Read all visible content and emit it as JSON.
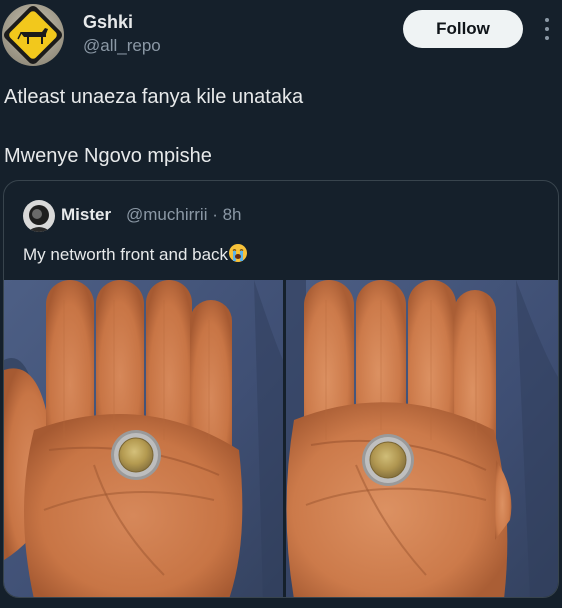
{
  "tweet": {
    "author_name": "Gshki",
    "author_handle": "@all_repo",
    "follow_label": "Follow",
    "avatar_icon": "cow-crossing-sign-icon",
    "text_lines": [
      "Atleast unaeza fanya kile unataka",
      "Mwenye Ngovo mpishe"
    ]
  },
  "quote": {
    "author_name": "Mister",
    "handle_time": "@muchirrii · 8h",
    "text": "My networth front and back",
    "emoji_icon": "loudly-crying-face-icon",
    "photos": [
      "open-palm-holding-coin-front",
      "open-palm-holding-coin-back"
    ]
  },
  "colors": {
    "background": "#15202b",
    "text_primary": "#e7e9ea",
    "text_secondary": "#8b98a5",
    "border": "#38444d",
    "follow_bg": "#eff3f4",
    "follow_text": "#0f1419"
  }
}
